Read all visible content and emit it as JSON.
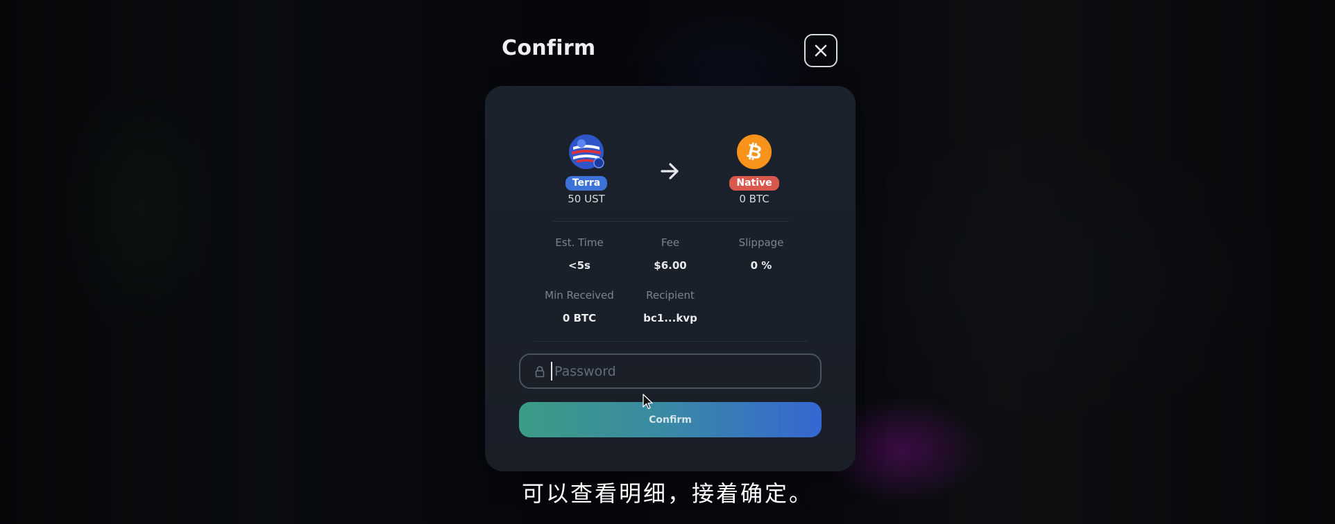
{
  "dialog": {
    "title": "Confirm",
    "close_icon": "close-icon"
  },
  "swap": {
    "from": {
      "icon": "terra-ust-icon",
      "chain": "Terra",
      "amount": "50 UST"
    },
    "to": {
      "icon": "bitcoin-icon",
      "chain": "Native",
      "amount": "0 BTC"
    },
    "arrow_icon": "arrow-right-icon"
  },
  "details": {
    "est_time": {
      "label": "Est. Time",
      "value": "<5s"
    },
    "fee": {
      "label": "Fee",
      "value": "$6.00"
    },
    "slippage": {
      "label": "Slippage",
      "value": "0 %"
    },
    "min_received": {
      "label": "Min Received",
      "value": "0 BTC"
    },
    "recipient": {
      "label": "Recipient",
      "value": "bc1...kvp"
    }
  },
  "password": {
    "placeholder": "Password",
    "value": "",
    "icon": "lock-icon"
  },
  "confirm_button": {
    "label": "Confirm"
  },
  "subtitle": "可以查看明细，接着确定。",
  "colors": {
    "card_bg": "#1b222d",
    "terra_badge": "#3d73d8",
    "native_badge": "#d9584d",
    "bitcoin_orange": "#f7931a",
    "button_gradient_start": "#3c9c84",
    "button_gradient_end": "#3567d2"
  }
}
